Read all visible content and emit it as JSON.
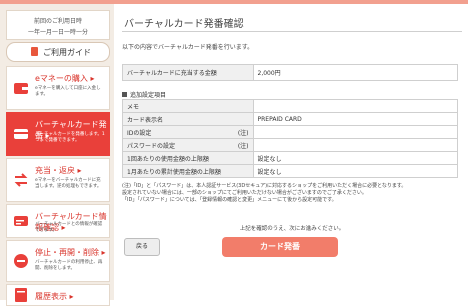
{
  "sidebar": {
    "last_login_label": "前回のご利用日時",
    "last_login_value": "一年一月一日一時一分",
    "guide_button": "ご利用ガイド",
    "items": [
      {
        "title": "eマネーの購入 ▸",
        "desc": "eマネーを購入して口座に入金します。",
        "active": false
      },
      {
        "title": "バーチャルカード発番 ▸",
        "desc": "バーチャルカードを発番します。1つまで発番できます。",
        "active": true
      },
      {
        "title": "充当・返戻 ▸",
        "desc": "eマネーをバーチャルカードに充当します。逆の処理もできます。",
        "active": false
      },
      {
        "title": "バーチャルカード情報確認 ▸",
        "desc": "バーチャルカードとの情報が確認できます。",
        "active": false
      },
      {
        "title": "停止・再開・削除 ▸",
        "desc": "バーチャルカードの利用停止、再開、削除をします。",
        "active": false
      },
      {
        "title": "履歴表示 ▸",
        "desc": "",
        "active": false
      }
    ]
  },
  "main": {
    "title": "バーチャルカード発番確認",
    "intro": "以下の内容でバーチャルカード発番を行います。",
    "amount_label": "バーチャルカードに充当する金額",
    "amount_value": "2,000円",
    "section_title": "追加設定項目",
    "settings": [
      {
        "label": "メモ",
        "note": "",
        "value": ""
      },
      {
        "label": "カード表示名",
        "note": "",
        "value": "PREPAID CARD"
      },
      {
        "label": "IDの設定",
        "note": "(注)",
        "value": ""
      },
      {
        "label": "パスワードの設定",
        "note": "(注)",
        "value": ""
      },
      {
        "label": "1回あたりの使用金額の上限額",
        "note": "",
        "value": "設定なし"
      },
      {
        "label": "1月あたりの累計使用金額の上限額",
        "note": "",
        "value": "設定なし"
      }
    ],
    "note_1": "(注)「ID」と「パスワード」は、本人認証サービス(3Dセキュア)に対応するショップをご利用いただく場合に必要となります。",
    "note_2": "設定されていない場合には、一部のショップにてご利用いただけない場合がございますのでご了承ください。",
    "note_3": "「ID」「パスワード」については、「登録情報の確認と変更」メニューにて後から設定可能です。",
    "confirm_text": "上記を確認のうえ、次にお進みください。",
    "back_button": "戻る",
    "issue_button": "カード発番"
  },
  "colors": {
    "accent": "#e9403a",
    "button": "#f27d6a",
    "sidebar_bg": "#f3ece4"
  }
}
